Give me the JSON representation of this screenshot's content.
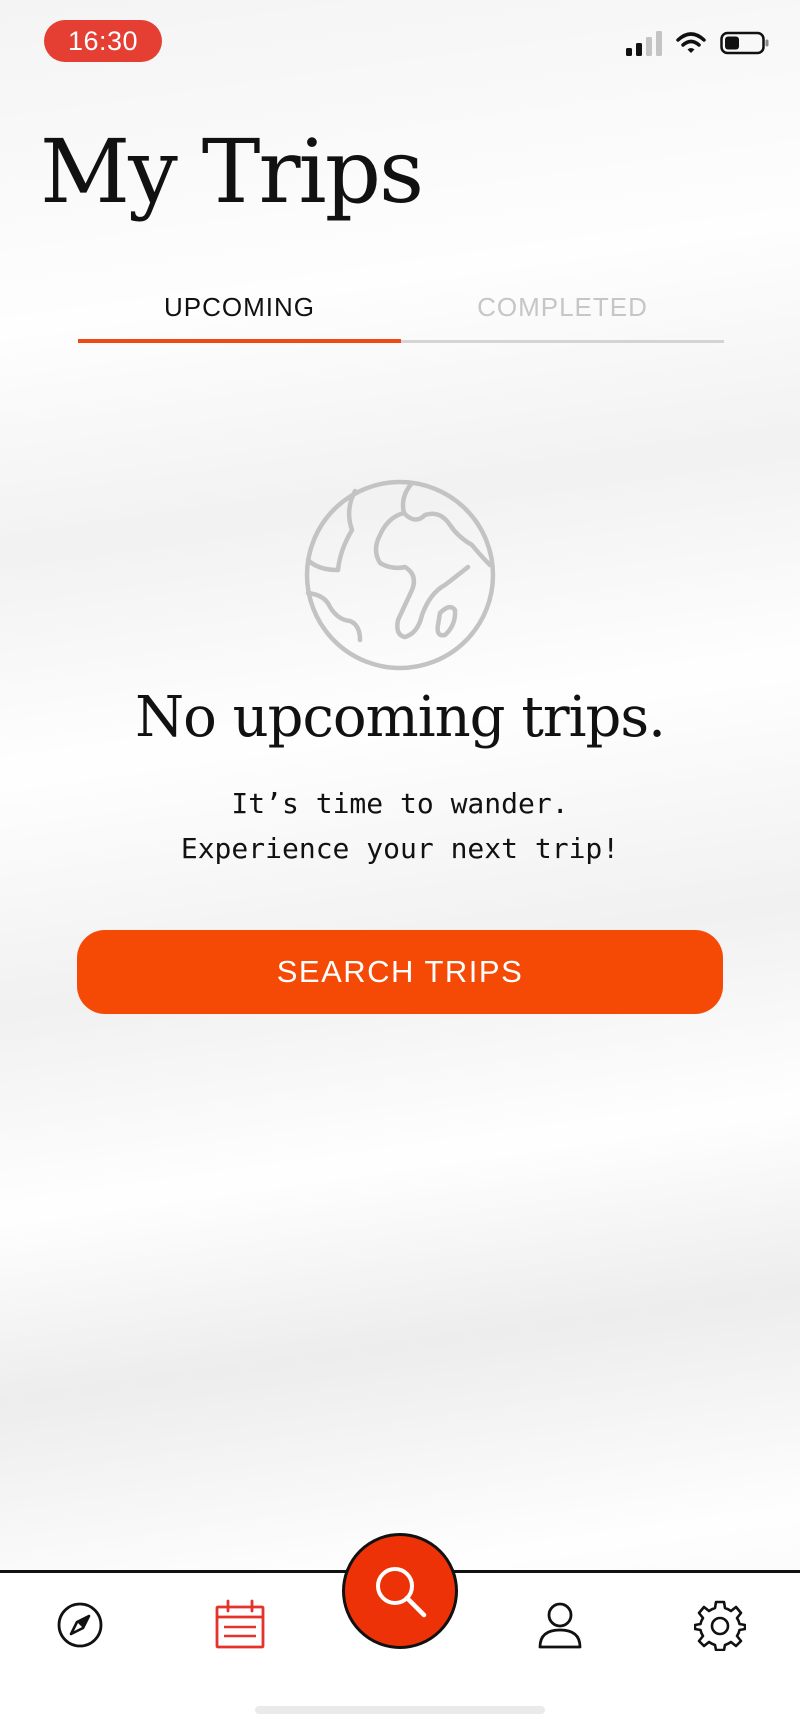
{
  "status_bar": {
    "time": "16:30"
  },
  "page": {
    "title": "My Trips"
  },
  "tabs": [
    {
      "label": "UPCOMING",
      "active": true
    },
    {
      "label": "COMPLETED",
      "active": false
    }
  ],
  "empty_state": {
    "icon": "globe-icon",
    "title": "No upcoming trips.",
    "subtitle_line1": "It’s time to wander.",
    "subtitle_line2": "Experience your next trip!"
  },
  "primary_button": {
    "label": "SEARCH TRIPS"
  },
  "bottom_nav": {
    "items": [
      {
        "icon": "compass-icon",
        "active": false
      },
      {
        "icon": "calendar-icon",
        "active": true
      },
      {
        "icon": "search-icon",
        "active": false,
        "prominent": true
      },
      {
        "icon": "user-icon",
        "active": false
      },
      {
        "icon": "gear-icon",
        "active": false
      }
    ]
  },
  "colors": {
    "accent": "#f54a05",
    "time_pill": "#e53f34",
    "inactive_tab": "#c6c6c6",
    "text": "#111111"
  }
}
